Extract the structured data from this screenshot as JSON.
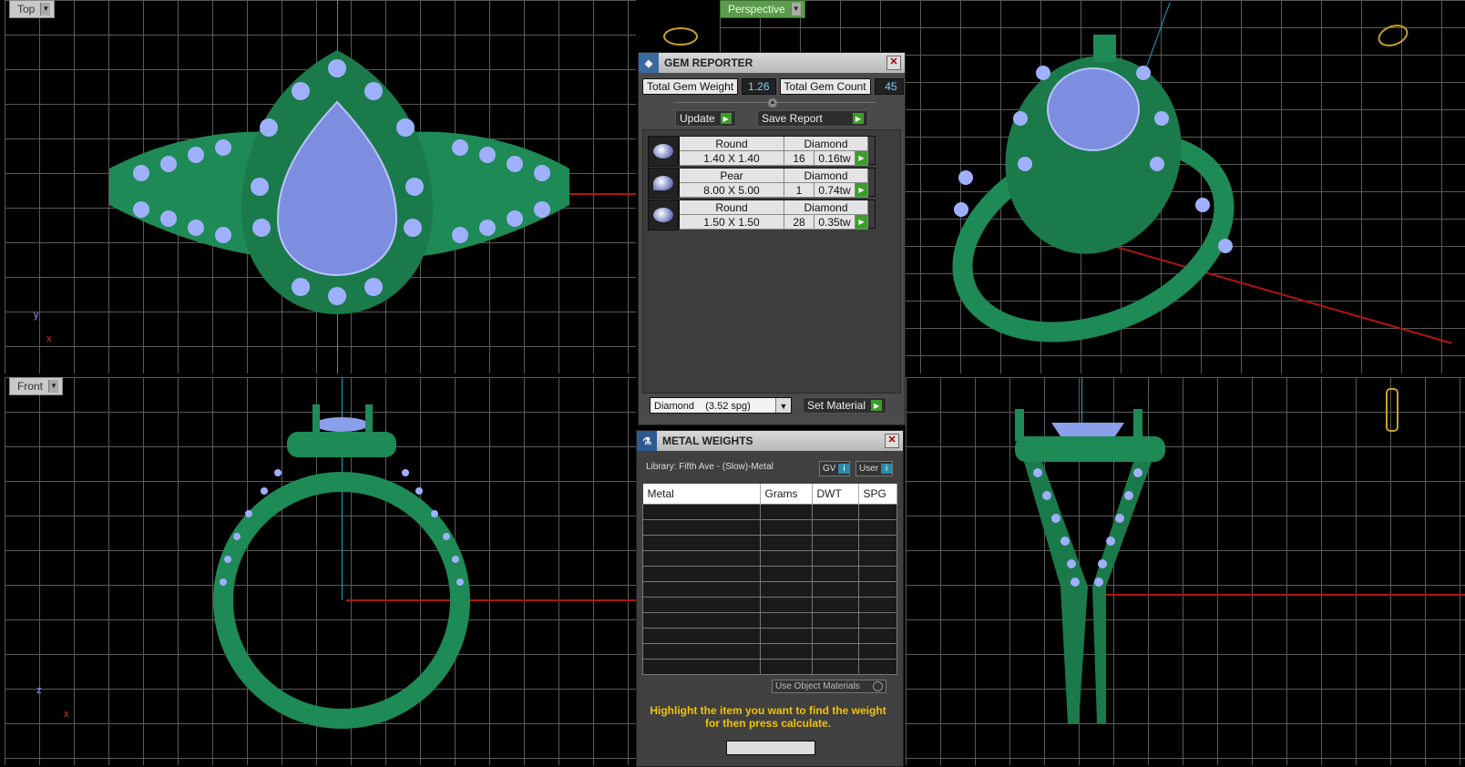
{
  "viewports": {
    "top": {
      "label": "Top",
      "axis_v": "y",
      "axis_h": "x"
    },
    "perspective": {
      "label": "Perspective"
    },
    "front": {
      "label": "Front",
      "axis_v": "z",
      "axis_h": "x"
    }
  },
  "gem_reporter": {
    "title": "GEM REPORTER",
    "total_weight_label": "Total Gem Weight",
    "total_weight_value": "1.26",
    "total_count_label": "Total Gem Count",
    "total_count_value": "45",
    "update_label": "Update",
    "save_report_label": "Save Report",
    "gems": [
      {
        "shape": "Round",
        "size": "1.40 X 1.40",
        "material": "Diamond",
        "count": "16",
        "weight": "0.16tw"
      },
      {
        "shape": "Pear",
        "size": "8.00 X 5.00",
        "material": "Diamond",
        "count": "1",
        "weight": "0.74tw"
      },
      {
        "shape": "Round",
        "size": "1.50 X 1.50",
        "material": "Diamond",
        "count": "28",
        "weight": "0.35tw"
      }
    ],
    "material_select": "Diamond    (3.52 spg)",
    "set_material_label": "Set Material"
  },
  "metal_weights": {
    "title": "METAL WEIGHTS",
    "library": "Library: Fifth Ave - (Slow)-Metal",
    "gv_label": "GV",
    "user_label": "User",
    "columns": [
      "Metal",
      "Grams",
      "DWT",
      "SPG"
    ],
    "use_object_materials": "Use Object Materials",
    "hint": "Highlight the item you want to find the weight for then press calculate."
  },
  "colors": {
    "metal": "#1e8a55",
    "gem": "#8aa0ea",
    "grid": "#5a5a5a",
    "accent_green": "#3c9e2a",
    "hint": "#f2c200"
  }
}
